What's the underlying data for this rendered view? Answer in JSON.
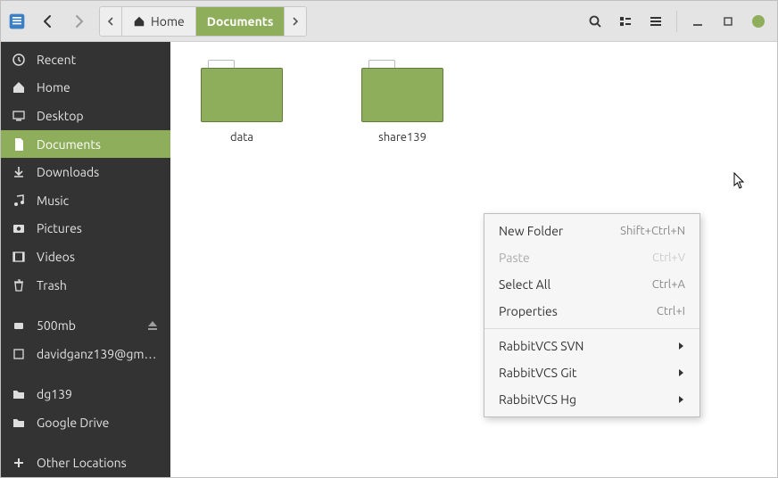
{
  "pathbar": {
    "home": "Home",
    "documents": "Documents"
  },
  "sidebar": {
    "recent": "Recent",
    "home": "Home",
    "desktop": "Desktop",
    "documents": "Documents",
    "downloads": "Downloads",
    "music": "Music",
    "pictures": "Pictures",
    "videos": "Videos",
    "trash": "Trash",
    "vol500": "500mb",
    "gmail": "davidganz139@gm…",
    "dg139": "dg139",
    "gdrive": "Google Drive",
    "other": "Other Locations"
  },
  "folders": {
    "f0": "data",
    "f1": "share139"
  },
  "menu": {
    "new_folder": "New Folder",
    "new_folder_accel": "Shift+Ctrl+N",
    "paste": "Paste",
    "paste_accel": "Ctrl+V",
    "select_all": "Select All",
    "select_all_accel": "Ctrl+A",
    "properties": "Properties",
    "properties_accel": "Ctrl+I",
    "svn": "RabbitVCS SVN",
    "git": "RabbitVCS Git",
    "hg": "RabbitVCS Hg"
  }
}
